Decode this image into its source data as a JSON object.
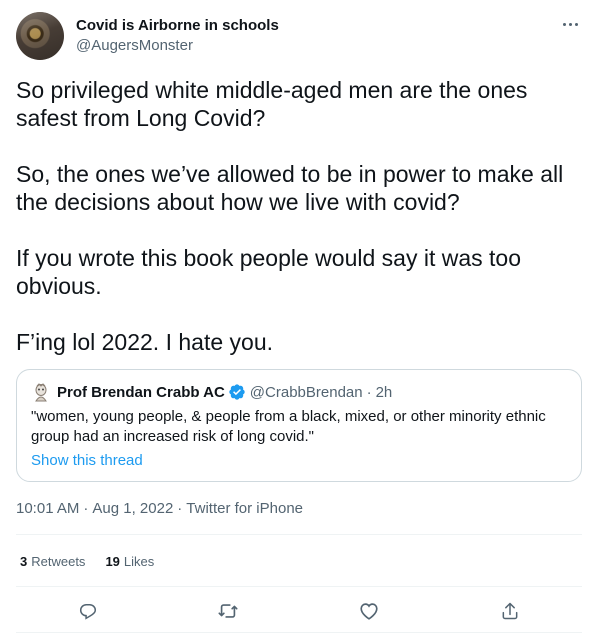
{
  "author": {
    "display_name": "Covid is Airborne in schools",
    "handle": "@AugersMonster"
  },
  "tweet": {
    "paragraphs": [
      "So privileged white middle-aged men are the ones safest from Long Covid?",
      "So, the ones we’ve allowed to be in power to make all the decisions about how we live with covid?",
      "If you wrote this book people would say it was too obvious.",
      "F’ing lol 2022. I hate you."
    ]
  },
  "quoted_tweet": {
    "display_name": "Prof Brendan Crabb AC",
    "handle": "@CrabbBrendan",
    "separator": "·",
    "time": "2h",
    "text": "\"women, young people, & people from a black, mixed, or other minority ethnic group had an increased risk of long covid.\"",
    "thread_link": "Show this thread"
  },
  "meta": {
    "time": "10:01 AM",
    "date": "Aug 1, 2022",
    "source": "Twitter for iPhone",
    "separator": "·"
  },
  "stats": {
    "retweets_count": "3",
    "retweets_label": "Retweets",
    "likes_count": "19",
    "likes_label": "Likes"
  },
  "colors": {
    "link": "#1d9bf0",
    "secondary_text": "#536471",
    "primary_text": "#0f1419",
    "border": "#cfd9de",
    "verified": "#1d9bf0"
  },
  "icons": {
    "reply": "reply-icon",
    "retweet": "retweet-icon",
    "like": "like-icon",
    "share": "share-icon",
    "more": "more-icon",
    "verified": "verified-badge-icon"
  }
}
